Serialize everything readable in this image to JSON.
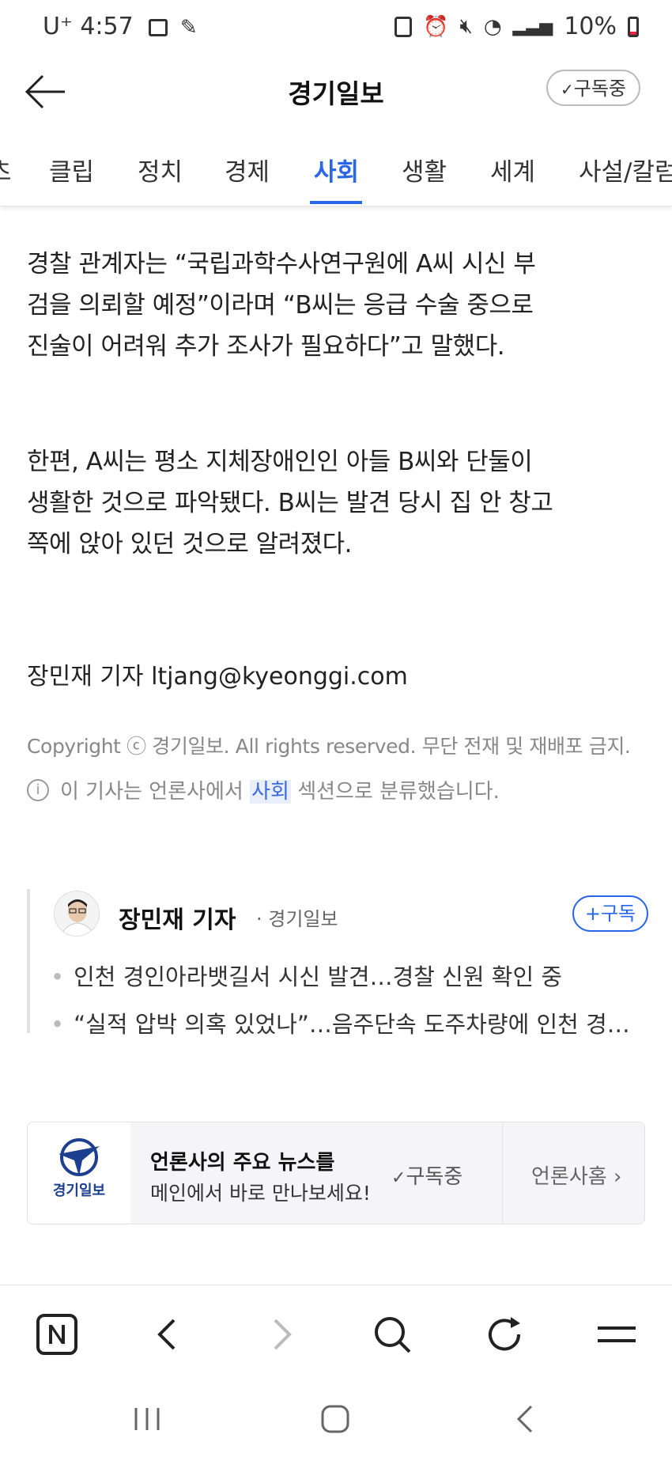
{
  "status_bar": {
    "carrier": "U⁺",
    "time": "4:57",
    "battery": "10%"
  },
  "header": {
    "title": "경기일보",
    "subscribe_label": "구독중"
  },
  "tabs": [
    {
      "label": "클립"
    },
    {
      "label": "정치"
    },
    {
      "label": "경제"
    },
    {
      "label": "사회",
      "active": true
    },
    {
      "label": "생활"
    },
    {
      "label": "세계"
    },
    {
      "label": "사설/칼럼"
    }
  ],
  "tab_partial_left": "츠",
  "article": {
    "para1": [
      "경찰 관계자는 “국립과학수사연구원에 A씨 시신 부",
      "검을 의뢰할 예정”이라며 “B씨는 응급 수술 중으로",
      "진술이 어려워 추가 조사가 필요하다”고 말했다."
    ],
    "para2": [
      "한편,  A씨는 평소 지체장애인인 아들 B씨와 단둘이",
      "생활한 것으로 파악됐다. B씨는 발견 당시 집 안 창고",
      "쪽에 앉아 있던 것으로 알려졌다."
    ],
    "byline": "장민재 기자 ltjang@kyeonggi.com",
    "copyright": "Copyright ⓒ 경기일보. All rights reserved. 무단 전재 및 재배포 금지.",
    "classify_prefix": "이 기사는 언론사에서",
    "classify_section": "사회",
    "classify_suffix": "섹션으로 분류했습니다."
  },
  "reporter": {
    "name": "장민재 기자",
    "publisher": "· 경기일보",
    "follow_label": "+구독",
    "articles": [
      "인천 경인아라뱃길서 시신 발견…경찰 신원 확인 중",
      "“실적 압박 의혹 있었나”…음주단속 도주차량에 인천 경…"
    ]
  },
  "press_card": {
    "logo_text": "경기일보",
    "title": "언론사의 주요 뉴스를",
    "desc": "메인에서 바로 만나보세요!",
    "subscribe_label": "구독중",
    "home_label": "언론사홈"
  },
  "colors": {
    "accent": "#2a67e8",
    "text": "#222222",
    "muted": "#888888"
  }
}
